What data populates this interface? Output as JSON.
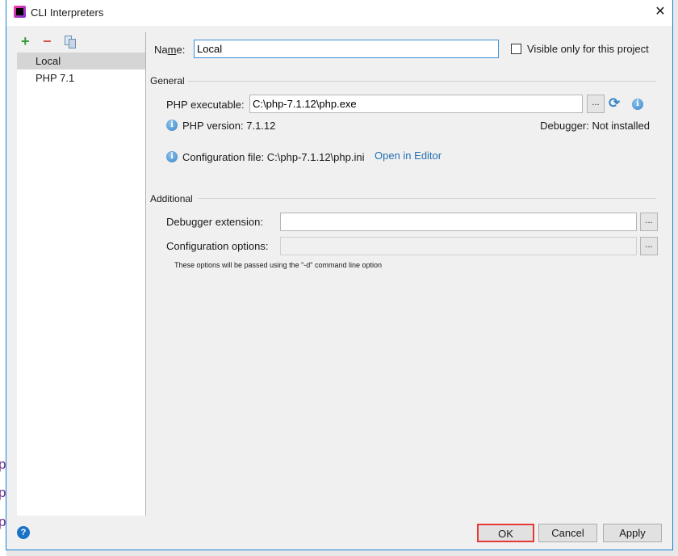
{
  "window": {
    "title": "CLI Interpreters",
    "close": "✕"
  },
  "toolbar": {
    "add": "+",
    "remove": "−"
  },
  "interpreters": [
    {
      "label": "Local"
    },
    {
      "label": "PHP 7.1"
    }
  ],
  "name": {
    "label_pre": "Na",
    "label_mn": "m",
    "label_post": "e:",
    "value": "Local"
  },
  "visible_only": {
    "label": "Visible only for this project",
    "checked": false
  },
  "general": {
    "title": "General",
    "exe_label": "PHP executable:",
    "exe_value": "C:\\php-7.1.12\\php.exe",
    "browse": "...",
    "version": "PHP version: 7.1.12",
    "debugger": "Debugger: Not installed",
    "config_file": "Configuration file: C:\\php-7.1.12\\php.ini",
    "open_editor": "Open in Editor"
  },
  "additional": {
    "title": "Additional",
    "debugger_ext_label": "Debugger extension:",
    "debugger_ext_value": "",
    "config_opts_label": "Configuration options:",
    "config_opts_value": "",
    "browse": "...",
    "hint": "These options will be passed using the \"-d\" command line option"
  },
  "buttons": {
    "help": "?",
    "ok": "OK",
    "cancel": "Cancel",
    "apply": "Apply"
  },
  "colors": {
    "accent": "#1883d7",
    "link": "#2470b3",
    "highlight": "#e53935"
  }
}
